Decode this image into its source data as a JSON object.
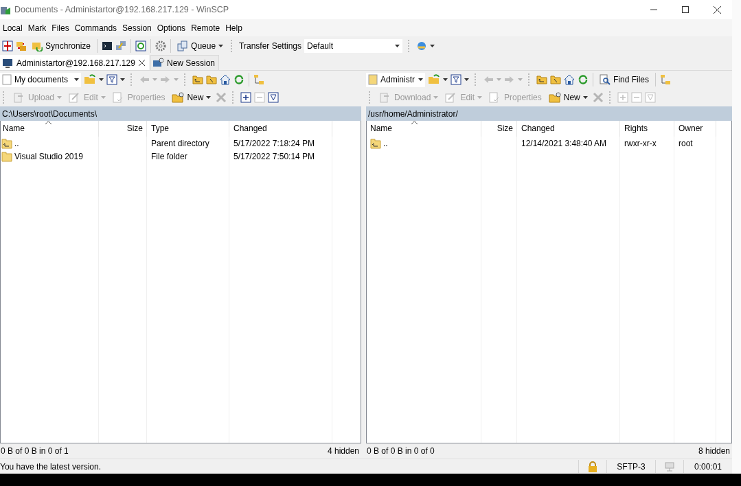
{
  "window": {
    "title": "Documents - Administartor@192.168.217.129 - WinSCP"
  },
  "menu": [
    "Local",
    "Mark",
    "Files",
    "Commands",
    "Session",
    "Options",
    "Remote",
    "Help"
  ],
  "toolbar": {
    "synchronize": "Synchronize",
    "queue": "Queue",
    "transfer_settings": "Transfer Settings",
    "preset": "Default"
  },
  "tabs": [
    {
      "label": "Administartor@192.168.217.129",
      "selected": true,
      "kind": "session"
    },
    {
      "label": "New Session",
      "selected": false,
      "kind": "new"
    }
  ],
  "left_panel": {
    "location": "My documents",
    "buttons": [
      {
        "label": "Upload",
        "disabled": true,
        "kind": "transfer"
      },
      {
        "label": "Edit",
        "disabled": true,
        "kind": "edit"
      },
      {
        "label": "Properties",
        "disabled": true,
        "kind": "properties"
      },
      {
        "label": "New",
        "disabled": false,
        "kind": "new"
      }
    ],
    "path": "C:\\Users\\root\\Documents\\",
    "columns": [
      "Name",
      "Size",
      "Type",
      "Changed"
    ],
    "rows": [
      {
        "kind": "parent",
        "name": "..",
        "type": "Parent directory",
        "changed": "5/17/2022  7:18:24 PM"
      },
      {
        "kind": "folder",
        "name": "Visual Studio 2019",
        "type": "File folder",
        "changed": "5/17/2022  7:50:14 PM"
      }
    ],
    "summary": "0 B of 0 B in 0 of 1",
    "hidden": "4 hidden"
  },
  "right_panel": {
    "location": "Administr",
    "find_files": "Find Files",
    "buttons": [
      {
        "label": "Download",
        "disabled": true,
        "kind": "transfer"
      },
      {
        "label": "Edit",
        "disabled": true,
        "kind": "edit"
      },
      {
        "label": "Properties",
        "disabled": true,
        "kind": "properties"
      },
      {
        "label": "New",
        "disabled": false,
        "kind": "new"
      }
    ],
    "path": "/usr/home/Administrator/",
    "columns": [
      "Name",
      "Size",
      "Changed",
      "Rights",
      "Owner"
    ],
    "rows": [
      {
        "kind": "parent",
        "name": "..",
        "changed": "12/14/2021 3:48:40 AM",
        "rights": "rwxr-xr-x",
        "owner": "root"
      }
    ],
    "summary": "0 B of 0 B in 0 of 0",
    "hidden": "8 hidden"
  },
  "status_bar": {
    "message": "You have the latest version.",
    "protocol": "SFTP-3",
    "elapsed": "0:00:01"
  }
}
